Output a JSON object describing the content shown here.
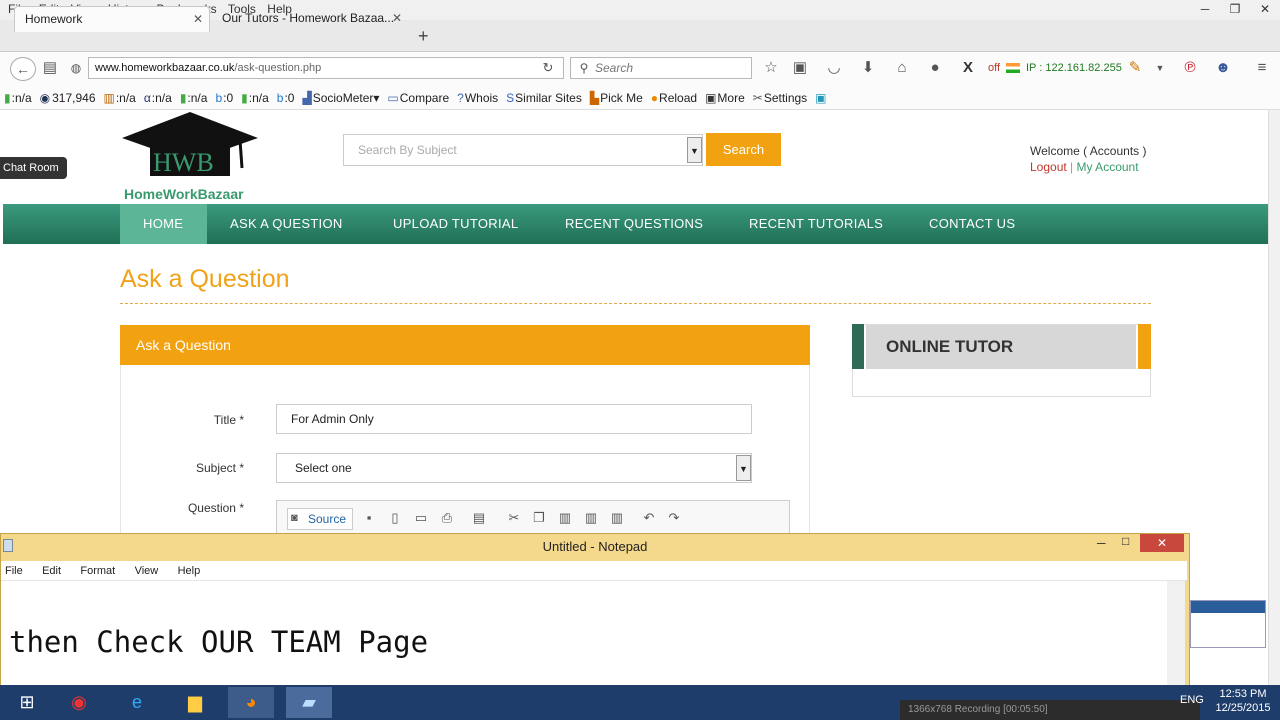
{
  "firefox": {
    "menu": [
      "File",
      "Edit",
      "View",
      "History",
      "Bookmarks",
      "Tools",
      "Help"
    ],
    "tabs": [
      {
        "title": "Homework",
        "active": true
      },
      {
        "title": "Our Tutors - Homework Bazaa...",
        "active": false
      }
    ],
    "url_host": "www.homeworkbazaar.co.uk",
    "url_path": "/ask-question.php",
    "search_placeholder": "Search",
    "ip_status": "off",
    "ip_text": "IP : 122.161.82.255",
    "bookmarks": [
      ":n/a",
      "317,946",
      ":n/a",
      ":n/a",
      ":n/a",
      ":0",
      ":n/a",
      ":0",
      "SocioMeter▾",
      "Compare",
      "Whois",
      "Similar Sites",
      "Pick Me",
      "Reload",
      "More",
      "Settings"
    ]
  },
  "site": {
    "logo_letters": "HWB",
    "logo_text": "HomeWorkBazaar",
    "chat_room": "Chat Room",
    "subject_search_placeholder": "Search By Subject",
    "search_button": "Search",
    "welcome": "Welcome ( Accounts )",
    "logout": "Logout",
    "separator": "|",
    "my_account": "My Account",
    "nav": [
      "HOME",
      "ASK A QUESTION",
      "UPLOAD TUTORIAL",
      "RECENT QUESTIONS",
      "RECENT TUTORIALS",
      "CONTACT US"
    ],
    "page_title": "Ask a Question",
    "form_header": "Ask a Question",
    "form": {
      "title_label": "Title *",
      "title_value": "For Admin Only",
      "subject_label": "Subject *",
      "subject_value": "Select one",
      "question_label": "Question *",
      "source_button": "Source"
    },
    "tutor_header": "ONLINE TUTOR"
  },
  "notepad": {
    "title": "Untitled - Notepad",
    "menu": [
      "File",
      "Edit",
      "Format",
      "View",
      "Help"
    ],
    "text": "then Check OUR TEAM Page"
  },
  "taskbar": {
    "lang": "ENG",
    "time": "12:53 PM",
    "date": "12/25/2015",
    "recording": "1366x768      Recording [00:05:50]"
  },
  "colors": {
    "accent": "#f2a211",
    "nav_green": "#2a8466",
    "link_red": "#c0392b"
  }
}
